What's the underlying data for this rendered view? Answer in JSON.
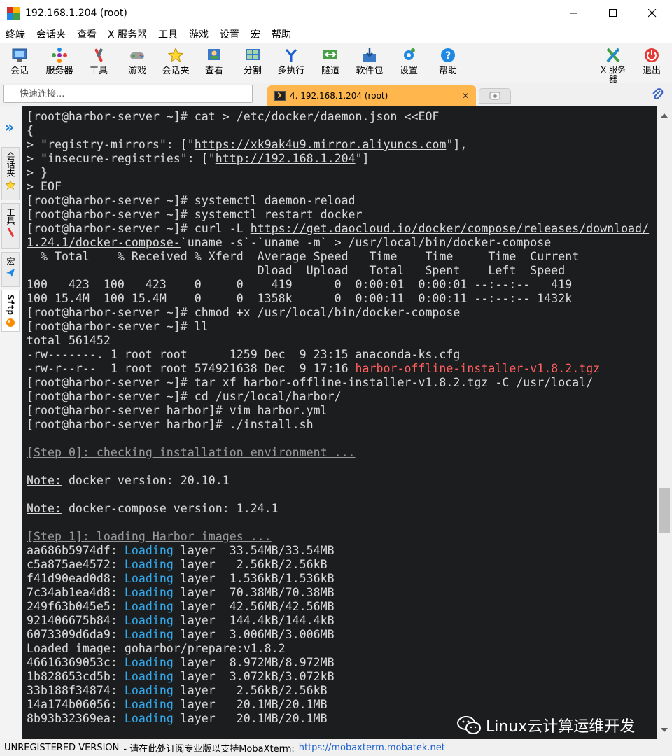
{
  "window": {
    "title": "192.168.1.204 (root)"
  },
  "menu": [
    "终端",
    "会话夹",
    "查看",
    "X 服务器",
    "工具",
    "游戏",
    "设置",
    "宏",
    "帮助"
  ],
  "toolbar": {
    "session": "会话",
    "servers": "服务器",
    "tools": "工具",
    "games": "游戏",
    "sessions": "会话夹",
    "view": "查看",
    "split": "分割",
    "multiexec": "多执行",
    "tunneling": "隧道",
    "packages": "软件包",
    "settings": "设置",
    "help": "帮助",
    "xserver": "X 服务器",
    "exit": "退出"
  },
  "quick_connect": {
    "placeholder": "快速连接..."
  },
  "tab": {
    "label": "4. 192.168.1.204 (root)"
  },
  "sidebar": {
    "sessions": "会话夹",
    "tools": "工具",
    "macros": "宏",
    "sftp": "Sftp"
  },
  "terminal": {
    "l1": "[root@harbor-server ~]# cat > /etc/docker/daemon.json <<EOF",
    "l2": "{",
    "l3a": "> \"registry-mirrors\": [\"",
    "l3b": "https://xk9ak4u9.mirror.aliyuncs.com",
    "l3c": "\"],",
    "l4a": "> \"insecure-registries\": [\"",
    "l4b": "http://192.168.1.204",
    "l4c": "\"]",
    "l5": "> }",
    "l6": "> EOF",
    "l7": "[root@harbor-server ~]# systemctl daemon-reload",
    "l8": "[root@harbor-server ~]# systemctl restart docker",
    "l9a": "[root@harbor-server ~]# curl -L ",
    "l9b": "https://get.daocloud.io/docker/compose/releases/download/",
    "l10a": "1.24.1/docker-compose-",
    "l10b": "`uname -s`-`uname -m` > /usr/local/bin/docker-compose",
    "l11": "  % Total    % Received % Xferd  Average Speed   Time    Time     Time  Current",
    "l12": "                                 Dload  Upload   Total   Spent    Left  Speed",
    "l13": "100   423  100   423    0     0    419      0  0:00:01  0:00:01 --:--:--   419",
    "l14": "100 15.4M  100 15.4M    0     0  1358k      0  0:00:11  0:00:11 --:--:-- 1432k",
    "l15": "[root@harbor-server ~]# chmod +x /usr/local/bin/docker-compose",
    "l16": "[root@harbor-server ~]# ll",
    "l17": "total 561452",
    "l18": "-rw-------. 1 root root      1259 Dec  9 23:15 anaconda-ks.cfg",
    "l19a": "-rw-r--r--  1 root root 574921638 Dec  9 17:16 ",
    "l19b": "harbor-offline-installer-v1.8.2.tgz",
    "l20": "[root@harbor-server ~]# tar xf harbor-offline-installer-v1.8.2.tgz -C /usr/local/",
    "l21": "[root@harbor-server ~]# cd /usr/local/harbor/",
    "l22": "[root@harbor-server harbor]# vim harbor.yml",
    "l23": "[root@harbor-server harbor]# ./install.sh",
    "l25": "[Step 0]: checking installation environment ...",
    "l27a": "Note:",
    "l27b": " docker version: 20.10.1",
    "l29a": "Note:",
    "l29b": " docker-compose version: 1.24.1",
    "l31": "[Step 1]: loading Harbor images ...",
    "loading_word": "Loading",
    "layers": [
      {
        "id": "aa686b5974df: ",
        "rest": " layer  33.54MB/33.54MB"
      },
      {
        "id": "c5a875ae4572: ",
        "rest": " layer   2.56kB/2.56kB"
      },
      {
        "id": "f41d90ead0d8: ",
        "rest": " layer  1.536kB/1.536kB"
      },
      {
        "id": "7c34ab1ea4d8: ",
        "rest": " layer  70.38MB/70.38MB"
      },
      {
        "id": "249f63b045e5: ",
        "rest": " layer  42.56MB/42.56MB"
      },
      {
        "id": "921406675b84: ",
        "rest": " layer  144.4kB/144.4kB"
      },
      {
        "id": "6073309d6da9: ",
        "rest": " layer  3.006MB/3.006MB"
      }
    ],
    "loaded_image": "Loaded image: goharbor/prepare:v1.8.2",
    "layers2": [
      {
        "id": "46616369053c: ",
        "rest": " layer  8.972MB/8.972MB"
      },
      {
        "id": "1b828653cd5b: ",
        "rest": " layer  3.072kB/3.072kB"
      },
      {
        "id": "33b188f34874: ",
        "rest": " layer   2.56kB/2.56kB"
      },
      {
        "id": "14a174b06056: ",
        "rest": " layer   20.1MB/20.1MB"
      },
      {
        "id": "8b93b32369ea: ",
        "rest": " layer   20.1MB/20.1MB"
      }
    ]
  },
  "status": {
    "unregistered": "UNREGISTERED VERSION",
    "message": " - 请在此处订阅专业版以支持MobaXterm: ",
    "link": "https://mobaxterm.mobatek.net"
  },
  "watermark": {
    "text": "Linux云计算运维开发"
  },
  "colors": {
    "terminal_bg": "#1b1d1e",
    "terminal_fg": "#d9d9d9",
    "tab_active": "#ffb74d",
    "loading": "#33aaee",
    "highlight_file": "#ff5f5f"
  }
}
